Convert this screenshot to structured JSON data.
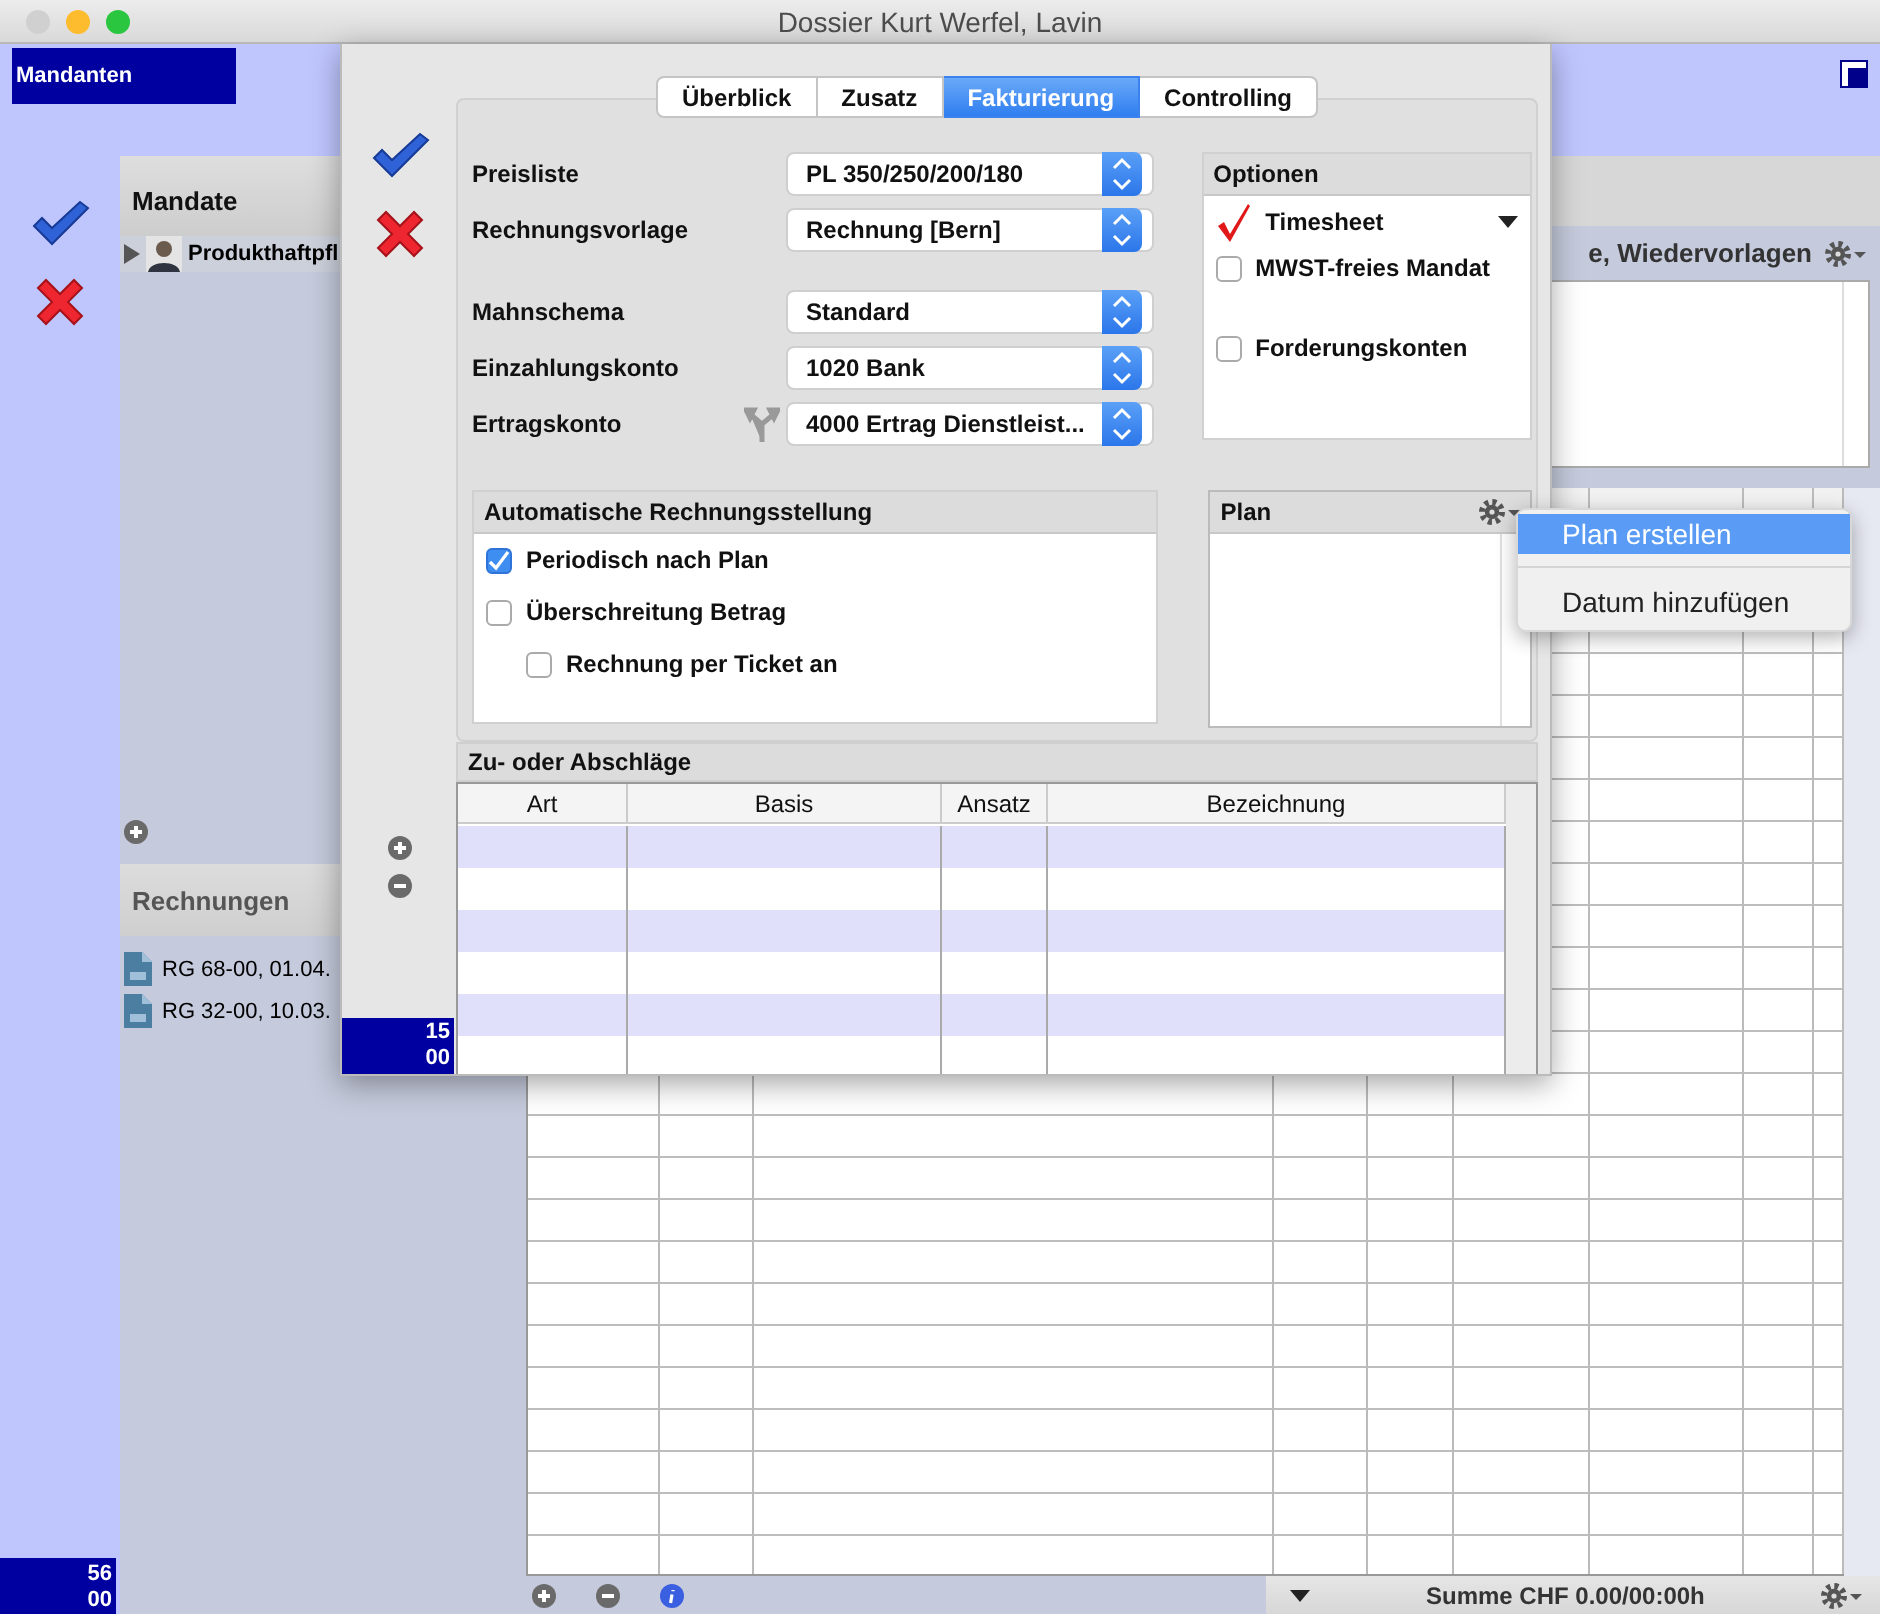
{
  "window": {
    "title": "Dossier Kurt Werfel, Lavin"
  },
  "sidebar": {
    "title": "Mandanten",
    "total": "56\n00"
  },
  "mandate": {
    "title": "Mandate",
    "items": [
      {
        "label": "Produkthaftpfl",
        "expanded": false
      }
    ]
  },
  "rechnungen": {
    "title": "Rechnungen",
    "items": [
      "RG 68-00, 01.04.",
      "RG 32-00, 10.03."
    ]
  },
  "notes_panel": {
    "title": "e, Wiedervorlagen"
  },
  "bottom_bar": {
    "summary": "Summe CHF 0.00/00:00h"
  },
  "sheet": {
    "tabs": [
      {
        "label": "Überblick",
        "selected": false
      },
      {
        "label": "Zusatz",
        "selected": false
      },
      {
        "label": "Fakturierung",
        "selected": true
      },
      {
        "label": "Controlling",
        "selected": false
      }
    ],
    "field_groups": [
      [
        {
          "label": "Preisliste",
          "value": "PL 350/250/200/180",
          "linked": false
        },
        {
          "label": "Rechnungsvorlage",
          "value": "Rechnung [Bern]",
          "linked": false
        }
      ],
      [
        {
          "label": "Mahnschema",
          "value": "Standard",
          "linked": false
        },
        {
          "label": "Einzahlungskonto",
          "value": "1020 Bank",
          "linked": false
        },
        {
          "label": "Ertragskonto",
          "value": "4000 Ertrag Dienstleist...",
          "linked": true
        }
      ]
    ],
    "options": {
      "title": "Optionen",
      "items": [
        {
          "label": "Timesheet",
          "kind": "menu",
          "checked": true
        },
        {
          "label": "MWST-freies Mandat",
          "kind": "checkbox",
          "checked": false
        },
        {
          "label": "Forderungskonten",
          "kind": "checkbox",
          "checked": false
        }
      ]
    },
    "auto_billing": {
      "title": "Automatische Rechnungsstellung",
      "items": [
        {
          "label": "Periodisch nach Plan",
          "checked": true
        },
        {
          "label": "Überschreitung Betrag",
          "checked": false,
          "children": [
            {
              "label": "Rechnung per Ticket an",
              "checked": false
            }
          ]
        }
      ]
    },
    "plan": {
      "title": "Plan"
    },
    "adjustments": {
      "title": "Zu- oder Abschläge",
      "columns": [
        "Art",
        "Basis",
        "Ansatz",
        "Bezeichnung"
      ]
    },
    "total": "15\n00"
  },
  "context_menu": {
    "items": [
      {
        "label": "Plan erstellen",
        "selected": true
      },
      {
        "label": "Datum hinzufügen",
        "selected": false
      }
    ]
  }
}
